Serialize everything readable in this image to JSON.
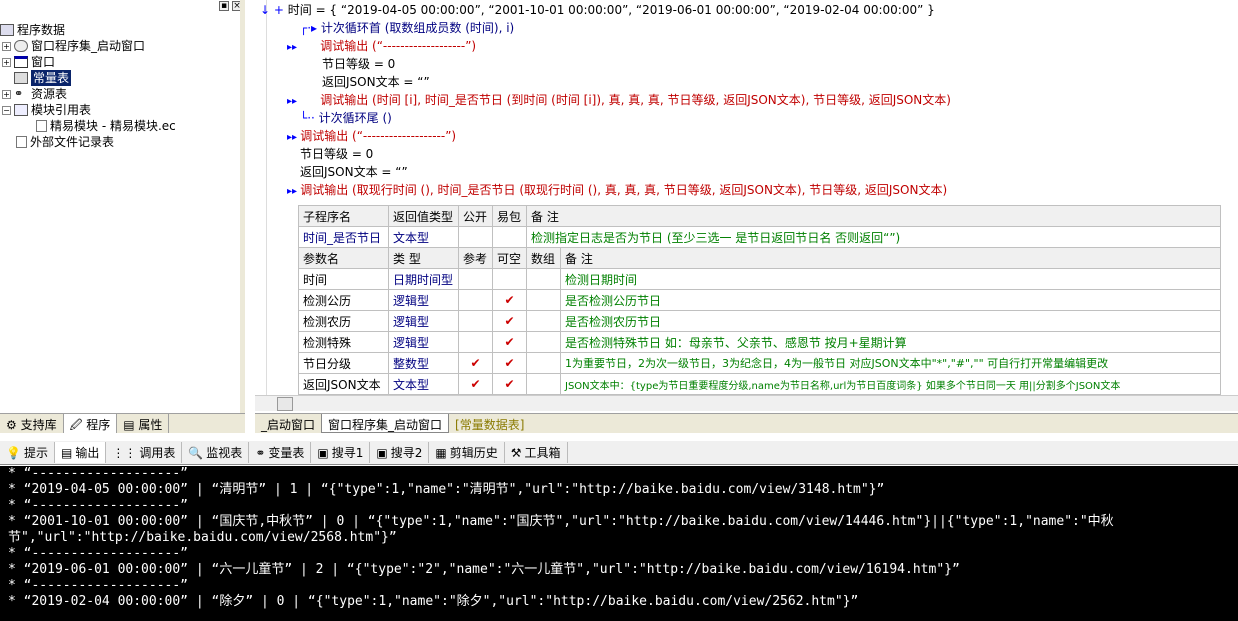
{
  "sidebar": {
    "items": [
      {
        "label": "程序数据"
      },
      {
        "label": "窗口程序集_启动窗口"
      },
      {
        "label": "窗口"
      },
      {
        "label": "常量表"
      },
      {
        "label": "资源表"
      },
      {
        "label": "模块引用表"
      },
      {
        "label": "精易模块 - 精易模块.ec"
      },
      {
        "label": "外部文件记录表"
      }
    ],
    "tabs": [
      {
        "label": "支持库"
      },
      {
        "label": "程序"
      },
      {
        "label": "属性"
      }
    ]
  },
  "code": {
    "l0_kw": "时间 = {",
    "l0_vals": "“2019-04-05 00:00:00”, “2001-10-01 00:00:00”, “2019-06-01 00:00:00”, “2019-02-04 00:00:00” }",
    "l1": "计次循环首 (取数组成员数 (时间), i)",
    "l2": "调试输出 (“-------------------”)",
    "l3": "节日等级 = 0",
    "l4": "返回JSON文本 = “”",
    "l5": "调试输出 (时间 [i], 时间_是否节日 (到时间 (时间 [i]), 真, 真, 真, 节日等级, 返回JSON文本), 节日等级, 返回JSON文本)",
    "l6": "计次循环尾 ()",
    "l7": "调试输出 (“-------------------”)",
    "l8": "节日等级 = 0",
    "l9": "返回JSON文本 = “”",
    "l10": "调试输出 (取现行时间 (), 时间_是否节日 (取现行时间 (), 真, 真, 真, 节日等级, 返回JSON文本), 节日等级, 返回JSON文本)"
  },
  "subtable": {
    "h1": [
      "子程序名",
      "返回值类型",
      "公开",
      "易包",
      "备 注"
    ],
    "r1": [
      "时间_是否节日",
      "文本型",
      "",
      "",
      "检测指定日志是否为节日 (至少三选一 是节日返回节日名 否则返回“”)"
    ],
    "h2": [
      "参数名",
      "类 型",
      "参考",
      "可空",
      "数组",
      "备 注"
    ],
    "params": [
      {
        "name": "时间",
        "type": "日期时间型",
        "ref": "",
        "nul": "",
        "arr": "",
        "note": "检测日期时间"
      },
      {
        "name": "检测公历",
        "type": "逻辑型",
        "ref": "",
        "nul": "✔",
        "arr": "",
        "note": "是否检测公历节日"
      },
      {
        "name": "检测农历",
        "type": "逻辑型",
        "ref": "",
        "nul": "✔",
        "arr": "",
        "note": "是否检测农历节日"
      },
      {
        "name": "检测特殊",
        "type": "逻辑型",
        "ref": "",
        "nul": "✔",
        "arr": "",
        "note": "是否检测特殊节日 如：母亲节、父亲节、感恩节 按月+星期计算"
      },
      {
        "name": "节日分级",
        "type": "整数型",
        "ref": "✔",
        "nul": "✔",
        "arr": "",
        "note": "1为重要节日，2为次一级节日，3为纪念日，4为一般节日  对应JSON文本中\"*\",\"#\",\"\" 可自行打开常量编辑更改"
      },
      {
        "name": "返回JSON文本",
        "type": "文本型",
        "ref": "✔",
        "nul": "✔",
        "arr": "",
        "note": "JSON文本中：{type为节日重要程度分级,name为节日名称,url为节日百度词条} 如果多个节日同一天 用||分割多个JSON文本"
      }
    ]
  },
  "editor_tabs": [
    {
      "label": "_启动窗口"
    },
    {
      "label": "窗口程序集_启动窗口"
    },
    {
      "label": "[常量数据表]"
    }
  ],
  "bottom_tabs": [
    {
      "label": "提示"
    },
    {
      "label": "输出"
    },
    {
      "label": "调用表"
    },
    {
      "label": "监视表"
    },
    {
      "label": "变量表"
    },
    {
      "label": "搜寻1"
    },
    {
      "label": "搜寻2"
    },
    {
      "label": "剪辑历史"
    },
    {
      "label": "工具箱"
    }
  ],
  "output": [
    "*  “-------------------”",
    "*  “2019-04-05 00:00:00” | “清明节” | 1 | “{\"type\":1,\"name\":\"清明节\",\"url\":\"http://baike.baidu.com/view/3148.htm\"}”",
    "*  “-------------------”",
    "*  “2001-10-01 00:00:00” | “国庆节,中秋节” | 0 | “{\"type\":1,\"name\":\"国庆节\",\"url\":\"http://baike.baidu.com/view/14446.htm\"}||{\"type\":1,\"name\":\"中秋",
    "节\",\"url\":\"http://baike.baidu.com/view/2568.htm\"}”",
    "*  “-------------------”",
    "*  “2019-06-01 00:00:00” | “六一儿童节” | 2 | “{\"type\":\"2\",\"name\":\"六一儿童节\",\"url\":\"http://baike.baidu.com/view/16194.htm\"}”",
    "*  “-------------------”",
    "*  “2019-02-04 00:00:00” | “除夕” | 0 | “{\"type\":1,\"name\":\"除夕\",\"url\":\"http://baike.baidu.com/view/2562.htm\"}”"
  ]
}
